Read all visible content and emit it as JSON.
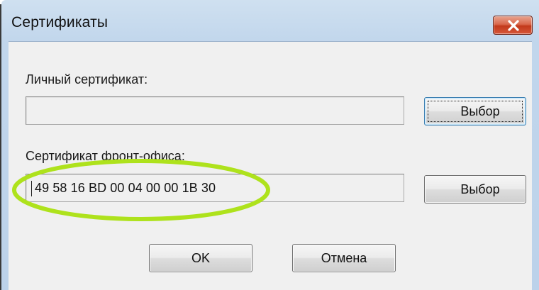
{
  "window": {
    "title": "Сертификаты",
    "close_icon": "close-icon"
  },
  "personal": {
    "label": "Личный сертификат:",
    "value": "",
    "button_label": "Выбор"
  },
  "front_office": {
    "label": "Сертификат фронт-офиса:",
    "value": "49 58 16 BD 00 04 00 00 1B 30",
    "button_label": "Выбор"
  },
  "footer": {
    "ok_label": "OK",
    "cancel_label": "Отмена"
  },
  "colors": {
    "title_bar": "#c1d6ec",
    "close_button": "#c2391b",
    "focus_border": "#3c7fb1",
    "annotation_highlight": "#aee21c"
  }
}
